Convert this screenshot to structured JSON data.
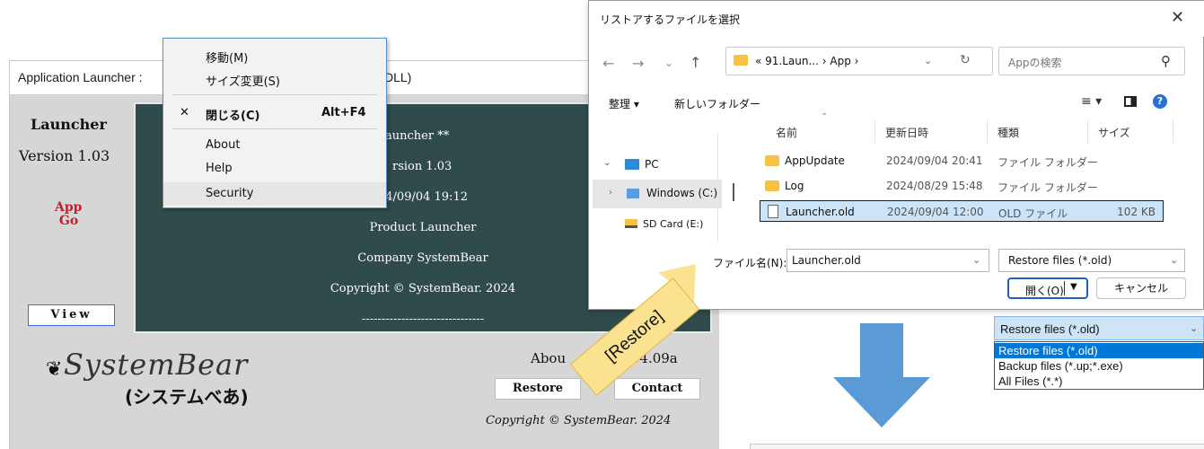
{
  "app": {
    "title": "Application Launcher :",
    "title_suffix": "DLL)",
    "name": "Launcher",
    "version": "Version 1.03",
    "icon_text": "App\n Go",
    "view_label": "View",
    "info_lines": [
      "auncher **",
      "rsion 1.03",
      "24/09/04 19:12",
      "Product Launcher",
      "Company SystemBear",
      "Copyright © SystemBear. 2024",
      "-------------------------------"
    ],
    "logo_en": "SystemBear",
    "logo_jp": "(システムべあ)",
    "about_text": "Abou",
    "ver_text": "Ver 4.09a",
    "restore_label": "Restore",
    "contact_label": "Contact",
    "copyright": "Copyright © SystemBear. 2024"
  },
  "context_menu": {
    "items": [
      {
        "label": "移動(M)",
        "check": "",
        "accel": ""
      },
      {
        "label": "サイズ変更(S)",
        "check": "",
        "accel": ""
      },
      {
        "label": "閉じる(C)",
        "check": "✕",
        "accel": "Alt+F4"
      },
      {
        "label": "About",
        "check": "",
        "accel": ""
      },
      {
        "label": "Help",
        "check": "",
        "accel": ""
      },
      {
        "label": "Security",
        "check": "",
        "accel": ""
      }
    ]
  },
  "dialog": {
    "title": "リストアするファイルを選択",
    "address": "« 91.Laun... › App ›",
    "search_placeholder": "Appの検索",
    "organize": "整理 ▾",
    "new_folder": "新しいフォルダー",
    "columns": {
      "name": "名前",
      "date": "更新日時",
      "type": "種類",
      "size": "サイズ"
    },
    "nav": {
      "pc": "PC",
      "windows": "Windows (C:)",
      "sdcard": "SD Card (E:)"
    },
    "files": [
      {
        "name": "AppUpdate",
        "date": "2024/09/04 20:41",
        "type": "ファイル フォルダー",
        "size": ""
      },
      {
        "name": "Log",
        "date": "2024/08/29 15:48",
        "type": "ファイル フォルダー",
        "size": ""
      },
      {
        "name": "Launcher.old",
        "date": "2024/09/04 12:00",
        "type": "OLD ファイル",
        "size": "102 KB"
      }
    ],
    "filename_label": "ファイル名(N):",
    "filename_value": "Launcher.old",
    "filetype_value": "Restore files (*.old)",
    "open_label": "開く(O)",
    "cancel_label": "キャンセル"
  },
  "filetype_dropdown": {
    "selected": "Restore files (*.old)",
    "options": [
      "Restore files (*.old)",
      "Backup files (*.up;*.exe)",
      "All Files (*.*)"
    ]
  },
  "annotation": {
    "banner": "[Restore]",
    "arrow_color": "#5b9bd5",
    "banner_color": "#fbe290"
  }
}
